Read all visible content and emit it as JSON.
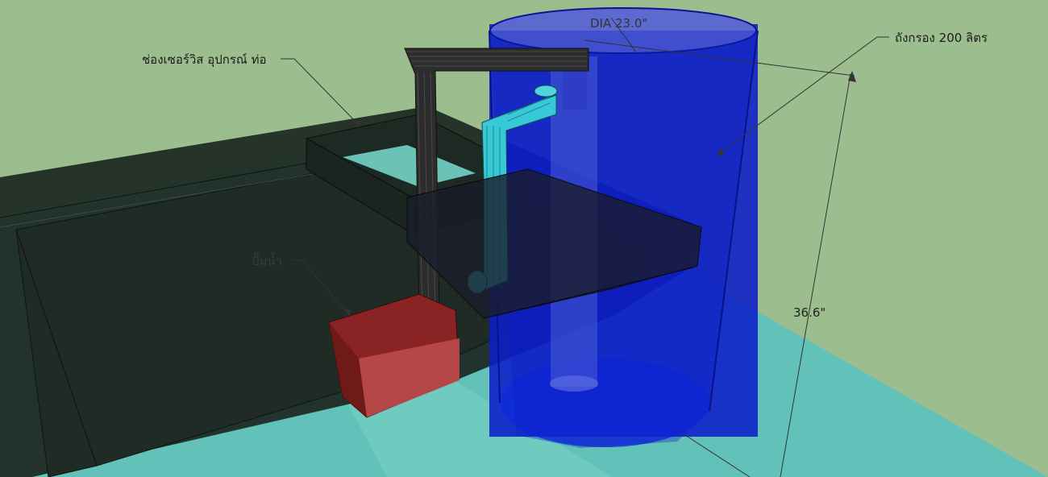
{
  "labels": {
    "service_opening": "ช่องเซอร์วิส อุปกรณ์ ท่อ",
    "pump": "ปั๊มน้ำ",
    "filter_tank": "ถังกรอง 200 ลิตร"
  },
  "dimensions": {
    "diameter": "DIA 23.0\"",
    "height": "36.6\""
  },
  "colors": {
    "background": "#9cbd8e",
    "tank": "#0c1ec8",
    "aquarium_water": "#62c1b8",
    "pump": "#8a2323",
    "return_pipe": "#37c9d6",
    "overflow_pipe": "#2d2d2d"
  }
}
